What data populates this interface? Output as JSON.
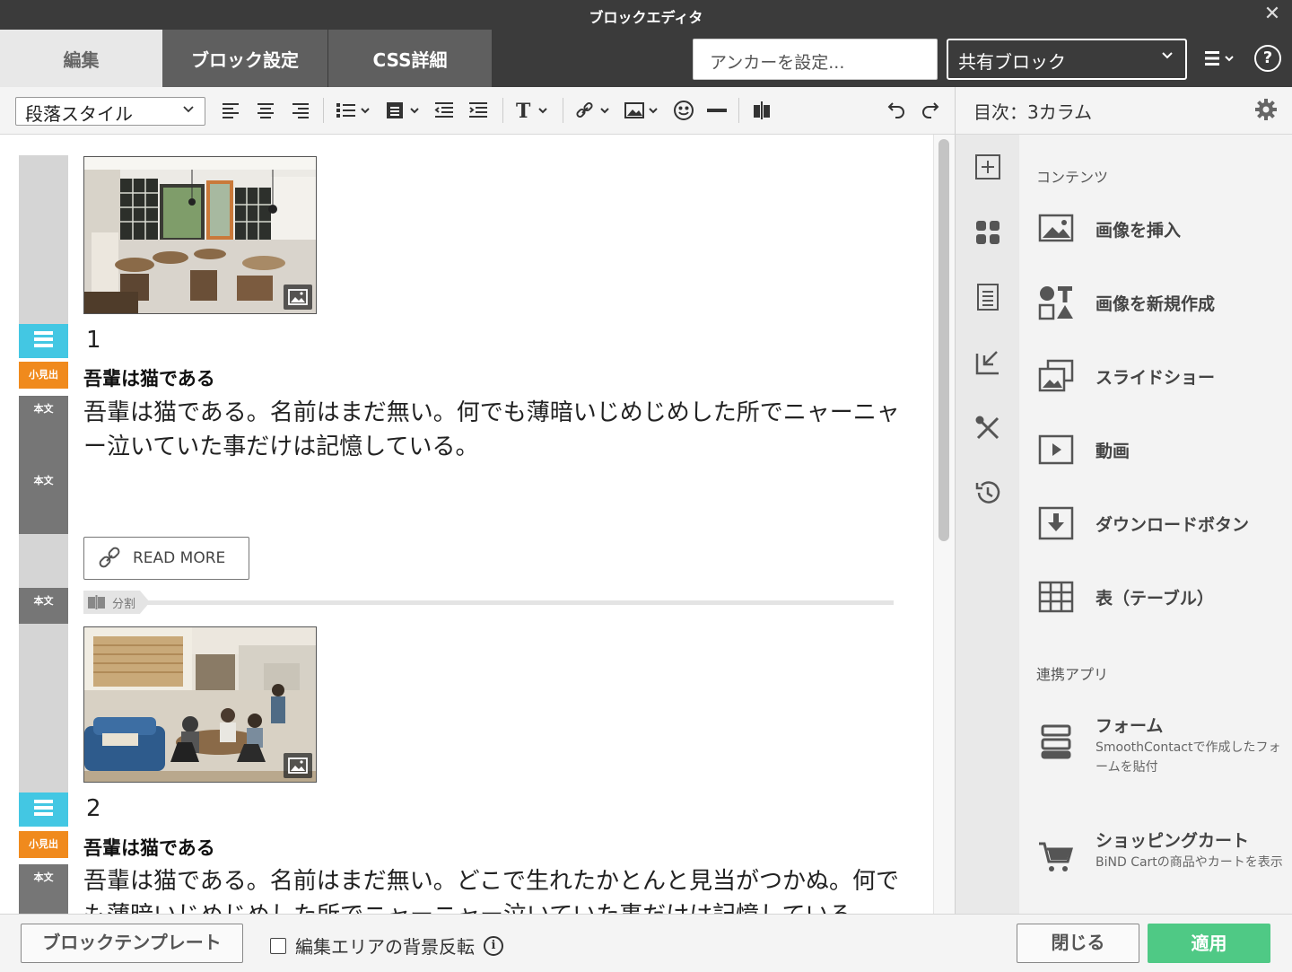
{
  "window": {
    "title": "ブロックエディタ",
    "close_symbol": "✕"
  },
  "tabs": [
    {
      "label": "編集"
    },
    {
      "label": "ブロック設定"
    },
    {
      "label": "CSS詳細"
    }
  ],
  "anchor": {
    "label": "アンカーを設定..."
  },
  "shared_block": {
    "value": "共有ブロック"
  },
  "help": {
    "symbol": "?"
  },
  "toolbar": {
    "paragraph_style": "段落スタイル",
    "buttons": [
      "align-left",
      "align-center",
      "align-right",
      "bullet-list",
      "block-format",
      "outdent",
      "indent",
      "text-style",
      "link",
      "image",
      "emoji",
      "horizontal-rule",
      "split",
      "undo",
      "redo"
    ]
  },
  "sidebar": {
    "header": "目次：3カラム",
    "rail": [
      "add",
      "parts",
      "page",
      "import",
      "tools",
      "history"
    ],
    "sections": [
      {
        "title": "コンテンツ",
        "items": [
          {
            "label": "画像を挿入",
            "icon": "image-icon"
          },
          {
            "label": "画像を新規作成",
            "icon": "shapes-icon"
          },
          {
            "label": "スライドショー",
            "icon": "slideshow-icon"
          },
          {
            "label": "動画",
            "icon": "video-icon"
          },
          {
            "label": "ダウンロードボタン",
            "icon": "download-icon"
          },
          {
            "label": "表（テーブル）",
            "icon": "table-icon"
          }
        ]
      },
      {
        "title": "連携アプリ",
        "items": [
          {
            "label": "フォーム",
            "desc": "SmoothContactで作成したフォームを貼付",
            "icon": "form-icon"
          },
          {
            "label": "ショッピングカート",
            "desc": "BiND Cartの商品やカートを表示",
            "icon": "cart-icon"
          }
        ]
      }
    ]
  },
  "editor": {
    "tags": {
      "midashi": "小見出",
      "honbun": "本文"
    },
    "blocks": [
      {
        "number": "1",
        "heading": "吾輩は猫である",
        "body": "吾輩は猫である。名前はまだ無い。何でも薄暗いじめじめした所でニャーニャー泣いていた事だけは記憶している。"
      },
      {
        "number": "2",
        "heading": "吾輩は猫である",
        "body": "吾輩は猫である。名前はまだ無い。どこで生れたかとんと見当がつかぬ。何でも薄暗いじめじめした所でニャーニャー泣いていた事だけは記憶している。"
      }
    ],
    "read_more": "READ MORE",
    "split_label": "分割"
  },
  "footer": {
    "template_button": "ブロックテンプレート",
    "invert_label": "編集エリアの背景反転",
    "invert_checked": false,
    "close_button": "閉じる",
    "apply_button": "適用",
    "apply_color": "#4fc985"
  }
}
